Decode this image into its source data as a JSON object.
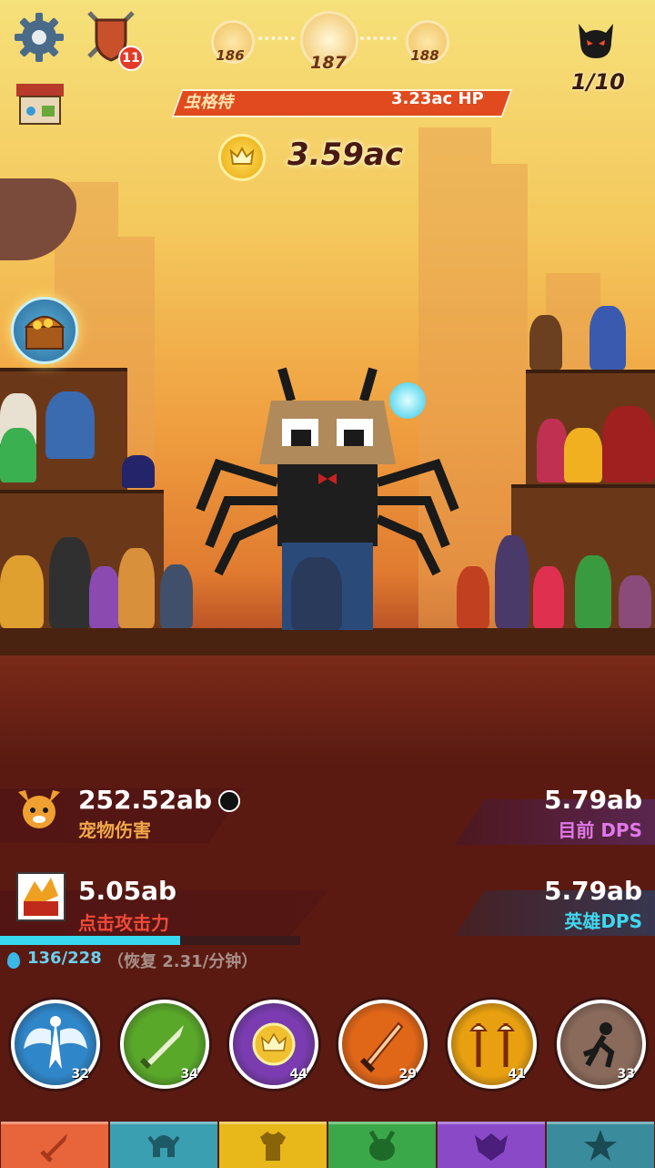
{
  "hud": {
    "chest_badge": "11",
    "stages": [
      "186",
      "187",
      "188"
    ],
    "boss_name": "虫格特",
    "boss_hp": "3.23ac HP",
    "gold": "3.59ac",
    "wave": "1/10"
  },
  "stats": {
    "pet_damage_value": "252.52ab",
    "pet_damage_label": "宠物伤害",
    "current_dps_value": "5.79ab",
    "current_dps_label": "目前 DPS",
    "tap_damage_value": "5.05ab",
    "tap_damage_label": "点击攻击力",
    "hero_dps_value": "5.79ab",
    "hero_dps_label": "英雄DPS",
    "mana": "136/228",
    "mana_regen": "（恢复 2.31/分钟）",
    "mana_fraction": 0.6
  },
  "skills": [
    {
      "level": "32",
      "icon": "angel-icon",
      "color": "#2f86c9"
    },
    {
      "level": "34",
      "icon": "sword-strike-icon",
      "color": "#5aa82a"
    },
    {
      "level": "44",
      "icon": "gold-crown-coin-icon",
      "color": "#7a3cb0"
    },
    {
      "level": "29",
      "icon": "fire-sword-icon",
      "color": "#e06618"
    },
    {
      "level": "41",
      "icon": "weapons-icon",
      "color": "#e8a010"
    },
    {
      "level": "33",
      "icon": "shadow-runner-icon",
      "color": "#8a6a5a"
    }
  ],
  "tabs": [
    {
      "icon": "sword-tab-icon",
      "color": "#e8643a"
    },
    {
      "icon": "helmet-tab-icon",
      "color": "#3a9fb0"
    },
    {
      "icon": "armor-tab-icon",
      "color": "#e8b81a"
    },
    {
      "icon": "pet-tab-icon",
      "color": "#3aa848"
    },
    {
      "icon": "clan-tab-icon",
      "color": "#8a4ac8"
    },
    {
      "icon": "star-tab-icon",
      "color": "#3a8c9c"
    }
  ]
}
